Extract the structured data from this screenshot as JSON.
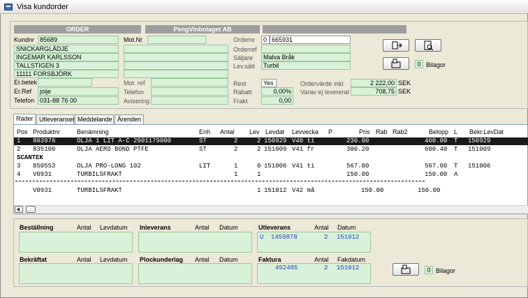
{
  "window": {
    "title": "Visa kundorder"
  },
  "header": {
    "left_bar": "ORDER",
    "right_bar": "PengVinbolaget AB"
  },
  "customer": {
    "kundnr_label": "Kundnr",
    "kundnr": "85689",
    "name1": "SNICKARGLÄDJE",
    "name2": "INGEMAR KARLSSON",
    "address": "TALLSTIGEN 3",
    "postal": "11111  FORSBJÖRK",
    "erbetek_label": "Er.betek",
    "erbetek": "",
    "erref_label": "Er.Ref",
    "erref": "joije",
    "telefon_label": "Telefon",
    "telefon": "031-88 76 00"
  },
  "mot": {
    "motnr_label": "Mot.Nr",
    "motnr": "",
    "motref_label": "Mot. ref",
    "telefon_label": "Telefon",
    "avisering_label": "Avisering"
  },
  "order": {
    "ordernr_label": "Ordernr",
    "ordernr_prefix": "0",
    "ordernr": "665931",
    "orderref_label": "Orderref",
    "orderref": "",
    "saljare_label": "Säljare",
    "saljare": "Malva Bråk",
    "levsatt_label": "Lev.sätt",
    "levsatt": "Turbil",
    "rest_label": "Rest",
    "rest": "Yes",
    "rabatt_label": "Rabatt",
    "rabatt": "0,00%",
    "frakt_label": "Frakt",
    "frakt": "0,00",
    "ordervarde_label": "Ordervärde inkl",
    "ordervarde": "2 222,00",
    "ordervarde_cur": "SEK",
    "varav_label": "Varav ej levererat",
    "varav": "708,75",
    "varav_cur": "SEK"
  },
  "bilagor": {
    "count": "0",
    "label": "Bilagor"
  },
  "tabs": [
    "Rader",
    "Utleveranser",
    "Meddelande",
    "Ärenden"
  ],
  "columns": {
    "pos": "Pos",
    "produktnr": "Produktnr",
    "benamning": "Benämning",
    "enh": "Enh",
    "antal": "Antal",
    "lev": "Lev",
    "levdat": "Levdat",
    "levvecka": "Levvecka",
    "p": "P",
    "pris": "Pris",
    "rab": "Rab",
    "rab2": "Rab2",
    "belopp": "Belopp",
    "l": "L",
    "bekr": "Bekr.LevDat"
  },
  "rows": [
    {
      "pos": "1",
      "produktnr": "803976",
      "benamning": "OLJA 1 LIT A-C 2901179000",
      "enh": "ST",
      "antal": "2",
      "lev": "2",
      "levdat": "150929",
      "levvecka": "V40 ti",
      "pris": "230.00",
      "belopp": "460.00",
      "l": "T",
      "bekr": "150929"
    },
    {
      "pos": "2",
      "produktnr": "835100",
      "benamning": "OLJA AERO BOND PTFE",
      "enh": "ST",
      "antal": "2",
      "lev": "2",
      "levdat": "151009",
      "levvecka": "V41 fr",
      "pris": "300.20",
      "belopp": "600.40",
      "l": "T",
      "bekr": "151009"
    },
    {
      "pos": "",
      "produktnr": "",
      "benamning": "SCANTEK",
      "enh": "",
      "antal": "",
      "lev": "",
      "levdat": "",
      "levvecka": "",
      "pris": "",
      "belopp": "",
      "l": "",
      "bekr": ""
    },
    {
      "pos": "3",
      "produktnr": "850553",
      "benamning": "OLJA PRO-LONG 102",
      "enh": "LIT",
      "antal": "1",
      "lev": "0",
      "levdat": "151006",
      "levvecka": "V41 ti",
      "pris": "567.00",
      "belopp": "567.00",
      "l": "T",
      "bekr": "151006"
    },
    {
      "pos": "4",
      "produktnr": "V0931",
      "benamning": "TURBILSFRAKT",
      "enh": "",
      "antal": "1",
      "lev": "1",
      "levdat": "",
      "levvecka": "",
      "pris": "150.00",
      "belopp": "150.00",
      "l": "A",
      "bekr": ""
    }
  ],
  "freight_line": {
    "produktnr": "V0931",
    "benamning": "TURBILSFRAKT",
    "lev": "1",
    "levdat": "151012",
    "levvecka": "V42 må",
    "pris": "150.00",
    "belopp": "150.00"
  },
  "bottom": {
    "bestallning": "Beställning",
    "antal": "Antal",
    "levdatum": "Levdatum",
    "inleverans": "Inleverans",
    "datum": "Datum",
    "utleverans": "Utleverans",
    "utlev_prefix": "U",
    "utlev_nr": "1459878",
    "utlev_antal": "2",
    "utlev_datum": "151012",
    "bekraftat": "Bekräftat",
    "plockunderlag": "Plockunderlag",
    "faktura": "Faktura",
    "faktura_nr": "492485",
    "faktura_antal": "2",
    "fakdatum": "Fakdatum",
    "faktura_datum": "151012"
  }
}
